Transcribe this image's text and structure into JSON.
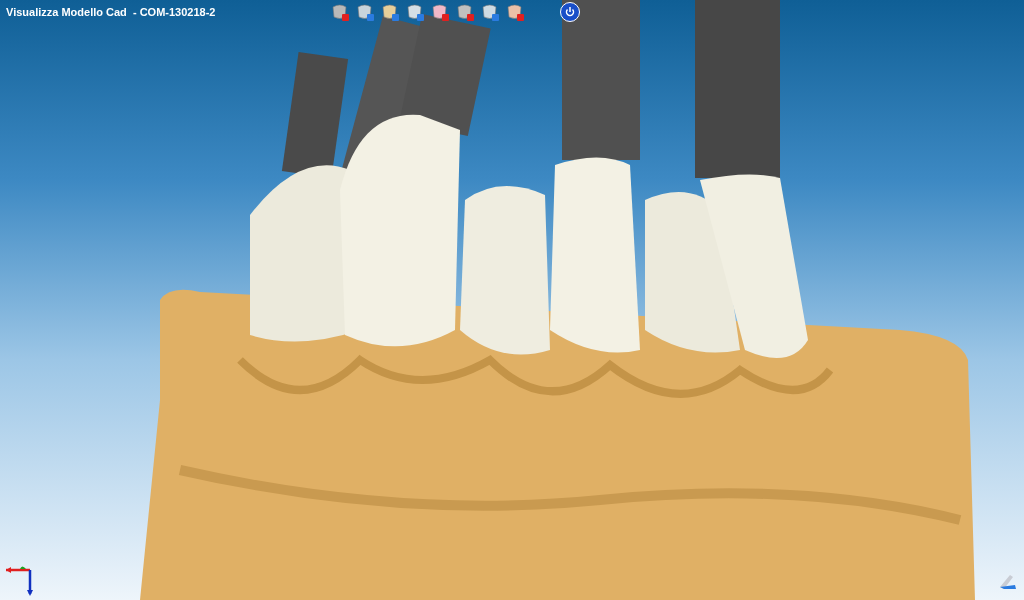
{
  "window": {
    "title": "Visualizza Modello Cad  - COM-130218-2"
  }
}
